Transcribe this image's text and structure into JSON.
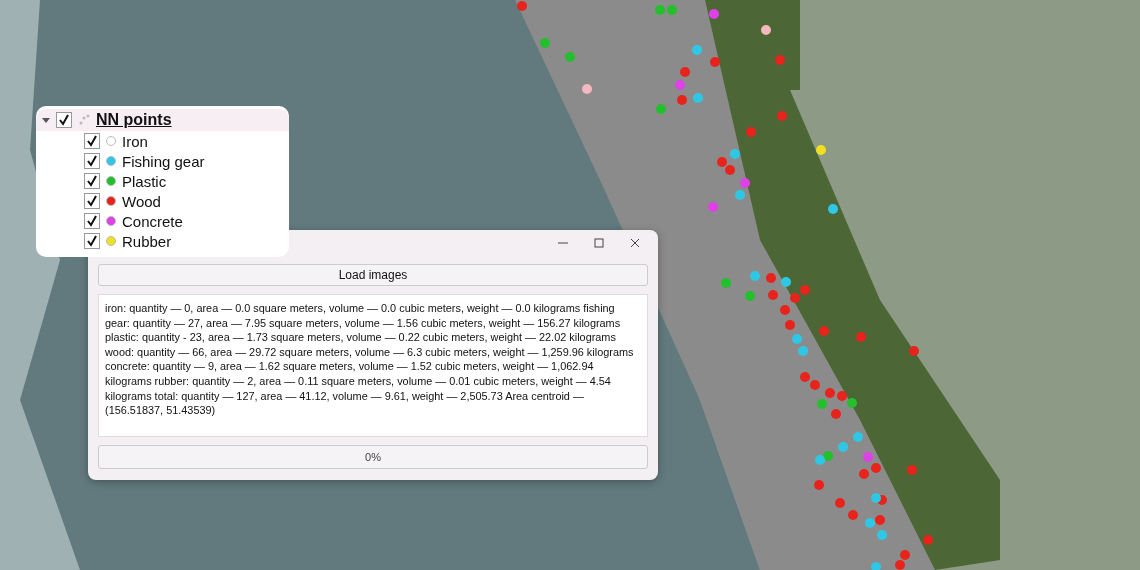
{
  "layer": {
    "name": "NN points",
    "expanded": true,
    "checked": true,
    "items": [
      {
        "label": "Iron",
        "checked": true,
        "color": "#ffffff"
      },
      {
        "label": "Fishing gear",
        "checked": true,
        "color": "#2ec8e6"
      },
      {
        "label": "Plastic",
        "checked": true,
        "color": "#22c02a"
      },
      {
        "label": "Wood",
        "checked": true,
        "color": "#e8231c"
      },
      {
        "label": "Concrete",
        "checked": true,
        "color": "#e040e8"
      },
      {
        "label": "Rubber",
        "checked": true,
        "color": "#f0e020"
      }
    ]
  },
  "dialog": {
    "button": "Load images",
    "output": "iron: quantity — 0, area — 0.0 square meters, volume — 0.0 cubic meters, weight — 0.0 kilograms fishing gear: quantity — 27, area — 7.95 square meters, volume — 1.56 cubic meters, weight — 156.27 kilograms plastic: quantity - 23, area — 1.73 square meters, volume — 0.22 cubic meters, weight — 22.02 kilograms wood: quantity — 66, area — 29.72 square meters, volume — 6.3 cubic meters, weight — 1,259.96 kilograms concrete: quantity — 9, area — 1.62 square meters, volume — 1.52 cubic meters, weight — 1,062.94 kilograms rubber: quantity — 2, area — 0.11 square meters, volume — 0.01 cubic meters, weight — 4.54 kilograms total: quantity — 127, area — 41.12, volume — 9.61, weight — 2,505.73 Area centroid — (156.51837, 51.43539)",
    "progress": {
      "label": "0%",
      "level": 0
    }
  }
}
